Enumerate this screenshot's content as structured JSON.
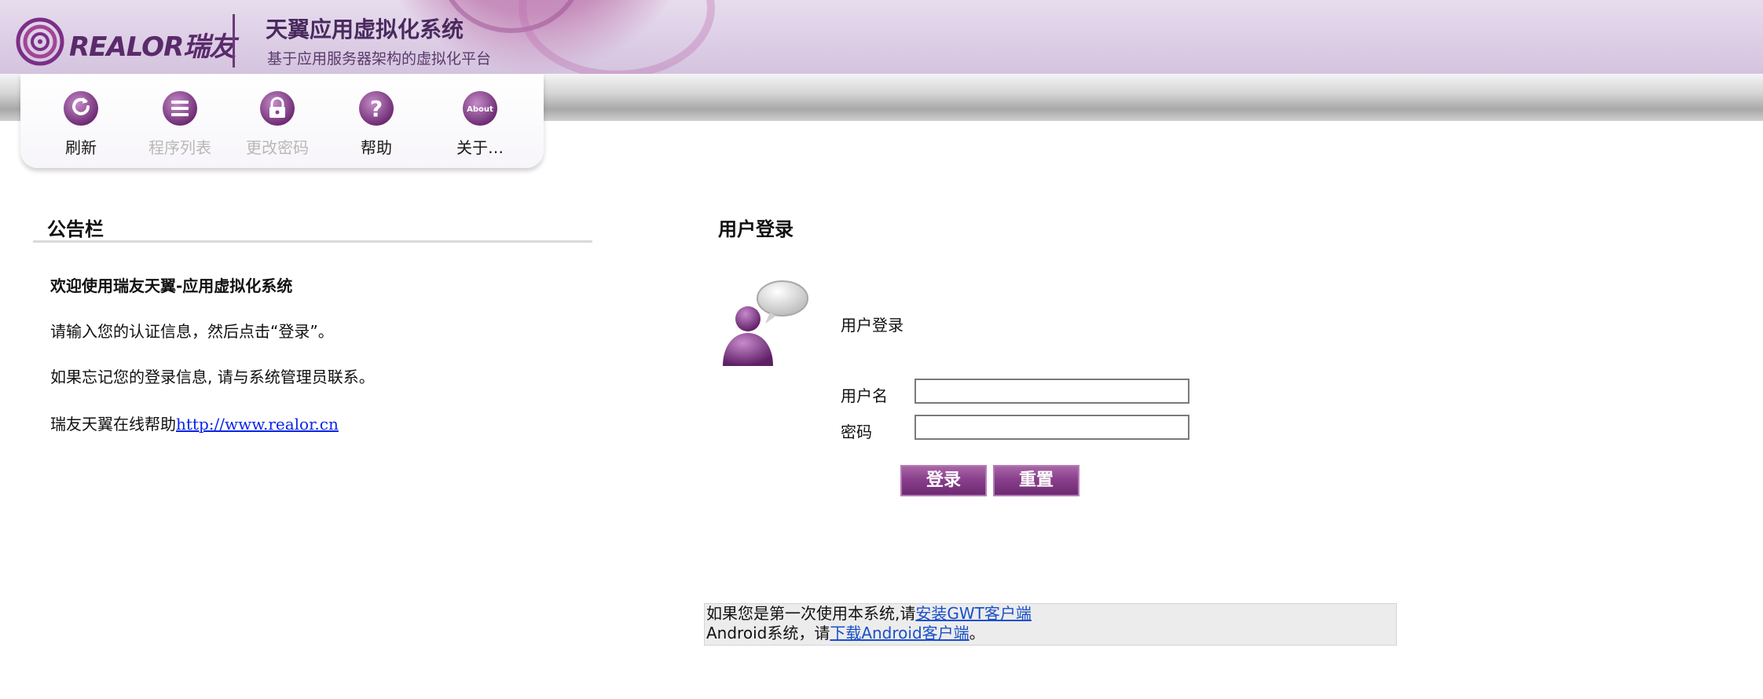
{
  "header": {
    "logo_text": "REALOR瑞友",
    "app_title": "天翼应用虚拟化系统",
    "app_subtitle": "基于应用服务器架构的虚拟化平台"
  },
  "toolbar": {
    "items": [
      {
        "label": "刷新",
        "icon": "refresh-icon",
        "enabled": true
      },
      {
        "label": "程序列表",
        "icon": "list-icon",
        "enabled": false
      },
      {
        "label": "更改密码",
        "icon": "lock-icon",
        "enabled": false
      },
      {
        "label": "帮助",
        "icon": "help-icon",
        "enabled": true
      },
      {
        "label": "关于…",
        "icon": "about-icon",
        "enabled": true,
        "icon_text": "About"
      }
    ]
  },
  "bulletin": {
    "title": "公告栏",
    "welcome": "欢迎使用瑞友天翼-应用虚拟化系统",
    "instruction": "请输入您的认证信息，然后点击“登录”。",
    "forgot": "如果忘记您的登录信息, 请与系统管理员联系。",
    "help_prefix": "瑞友天翼在线帮助",
    "help_link": "http://www.realor.cn"
  },
  "login": {
    "title": "用户登录",
    "subtitle": "用户登录",
    "username_label": "用户名",
    "username_value": "",
    "password_label": "密码",
    "password_value": "",
    "login_button": "登录",
    "reset_button": "重置"
  },
  "notice": {
    "line1_prefix": "如果您是第一次使用本系统,请",
    "install_link": "安装GWT客户端",
    "line2_prefix": "Android系统，请",
    "android_link": "下载Android客户端",
    "line2_suffix": "。"
  },
  "colors": {
    "brand_purple": "#6d2a72",
    "link_blue": "#0a24e8"
  }
}
